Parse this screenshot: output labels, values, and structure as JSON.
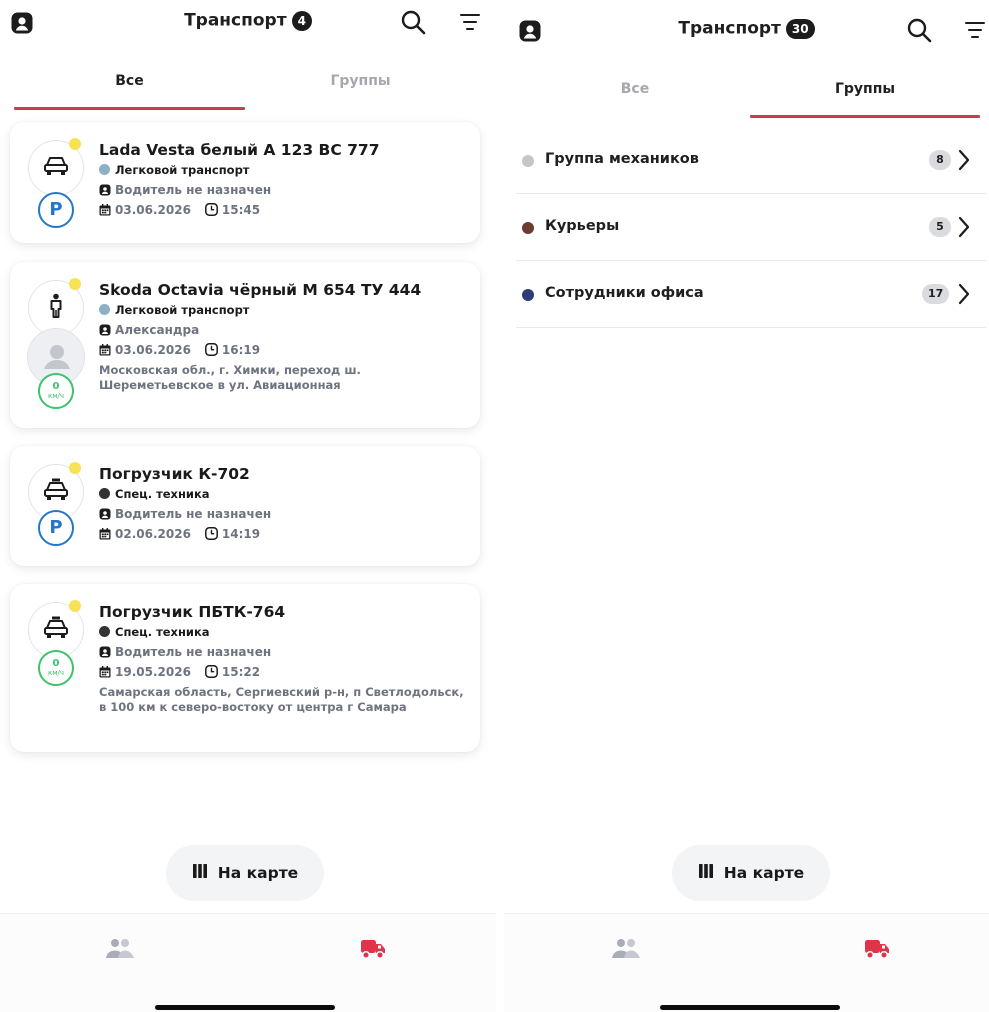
{
  "left": {
    "header": {
      "title": "Транспорт",
      "count": "4"
    },
    "tabs": [
      {
        "label": "Все",
        "active": true
      },
      {
        "label": "Группы",
        "active": false
      }
    ],
    "vehicles": [
      {
        "name": "Lada Vesta белый А 123 ВС 777",
        "type": "Легковой транспорт",
        "type_color": "#8db0c9",
        "driver": "Водитель не назначен",
        "date": "03.06.2026",
        "time": "15:45",
        "status_icon": "parking-icon"
      },
      {
        "name": "Skoda Octavia чёрный М 654 ТУ 444",
        "type": "Легковой транспорт",
        "type_color": "#8db0c9",
        "driver": "Александра",
        "date": "03.06.2026",
        "time": "16:19",
        "speed": "0",
        "speed_unit": "км/ч",
        "address": "Московская обл., г. Химки, переход ш. Шереметьевское в ул. Авиационная"
      },
      {
        "name": "Погрузчик К-702",
        "type": "Спец. техника",
        "type_color": "#333333",
        "driver": "Водитель не назначен",
        "date": "02.06.2026",
        "time": "14:19",
        "status_icon": "parking-icon"
      },
      {
        "name": "Погрузчик ПБТК-764",
        "type": "Спец. техника",
        "type_color": "#333333",
        "driver": "Водитель не назначен",
        "date": "19.05.2026",
        "time": "15:22",
        "speed": "0",
        "speed_unit": "км/ч",
        "address": "Самарская область, Сергиевский р-н, п Светлодольск, в 100 км к северо-востоку от центра г Самара"
      }
    ],
    "map_button": "На карте"
  },
  "right": {
    "header": {
      "title": "Транспорт",
      "count": "30"
    },
    "tabs": [
      {
        "label": "Все",
        "active": false
      },
      {
        "label": "Группы",
        "active": true
      }
    ],
    "groups": [
      {
        "name": "Группа механиков",
        "count": "8",
        "color": "#c4c6ca"
      },
      {
        "name": "Курьеры",
        "count": "5",
        "color": "#6e3b32"
      },
      {
        "name": "Сотрудники офиса",
        "count": "17",
        "color": "#2e3c78"
      }
    ],
    "map_button": "На карте"
  },
  "colors": {
    "accent": "#c93b4f",
    "parking": "#2277cc",
    "speed": "#3cc36c",
    "status_dot": "#f7e154",
    "muted_text": "#6e7380"
  },
  "icons": {
    "profile": "person-square-icon",
    "search": "search-icon",
    "filter": "filter-icon",
    "car": "car-icon",
    "person": "person-standing-icon",
    "driver": "person-square-icon",
    "calendar": "calendar-icon",
    "clock": "clock-icon",
    "parking": "parking-icon",
    "map": "map-icon",
    "chevron": "chevron-right-icon",
    "people": "people-icon",
    "truck": "truck-icon"
  }
}
